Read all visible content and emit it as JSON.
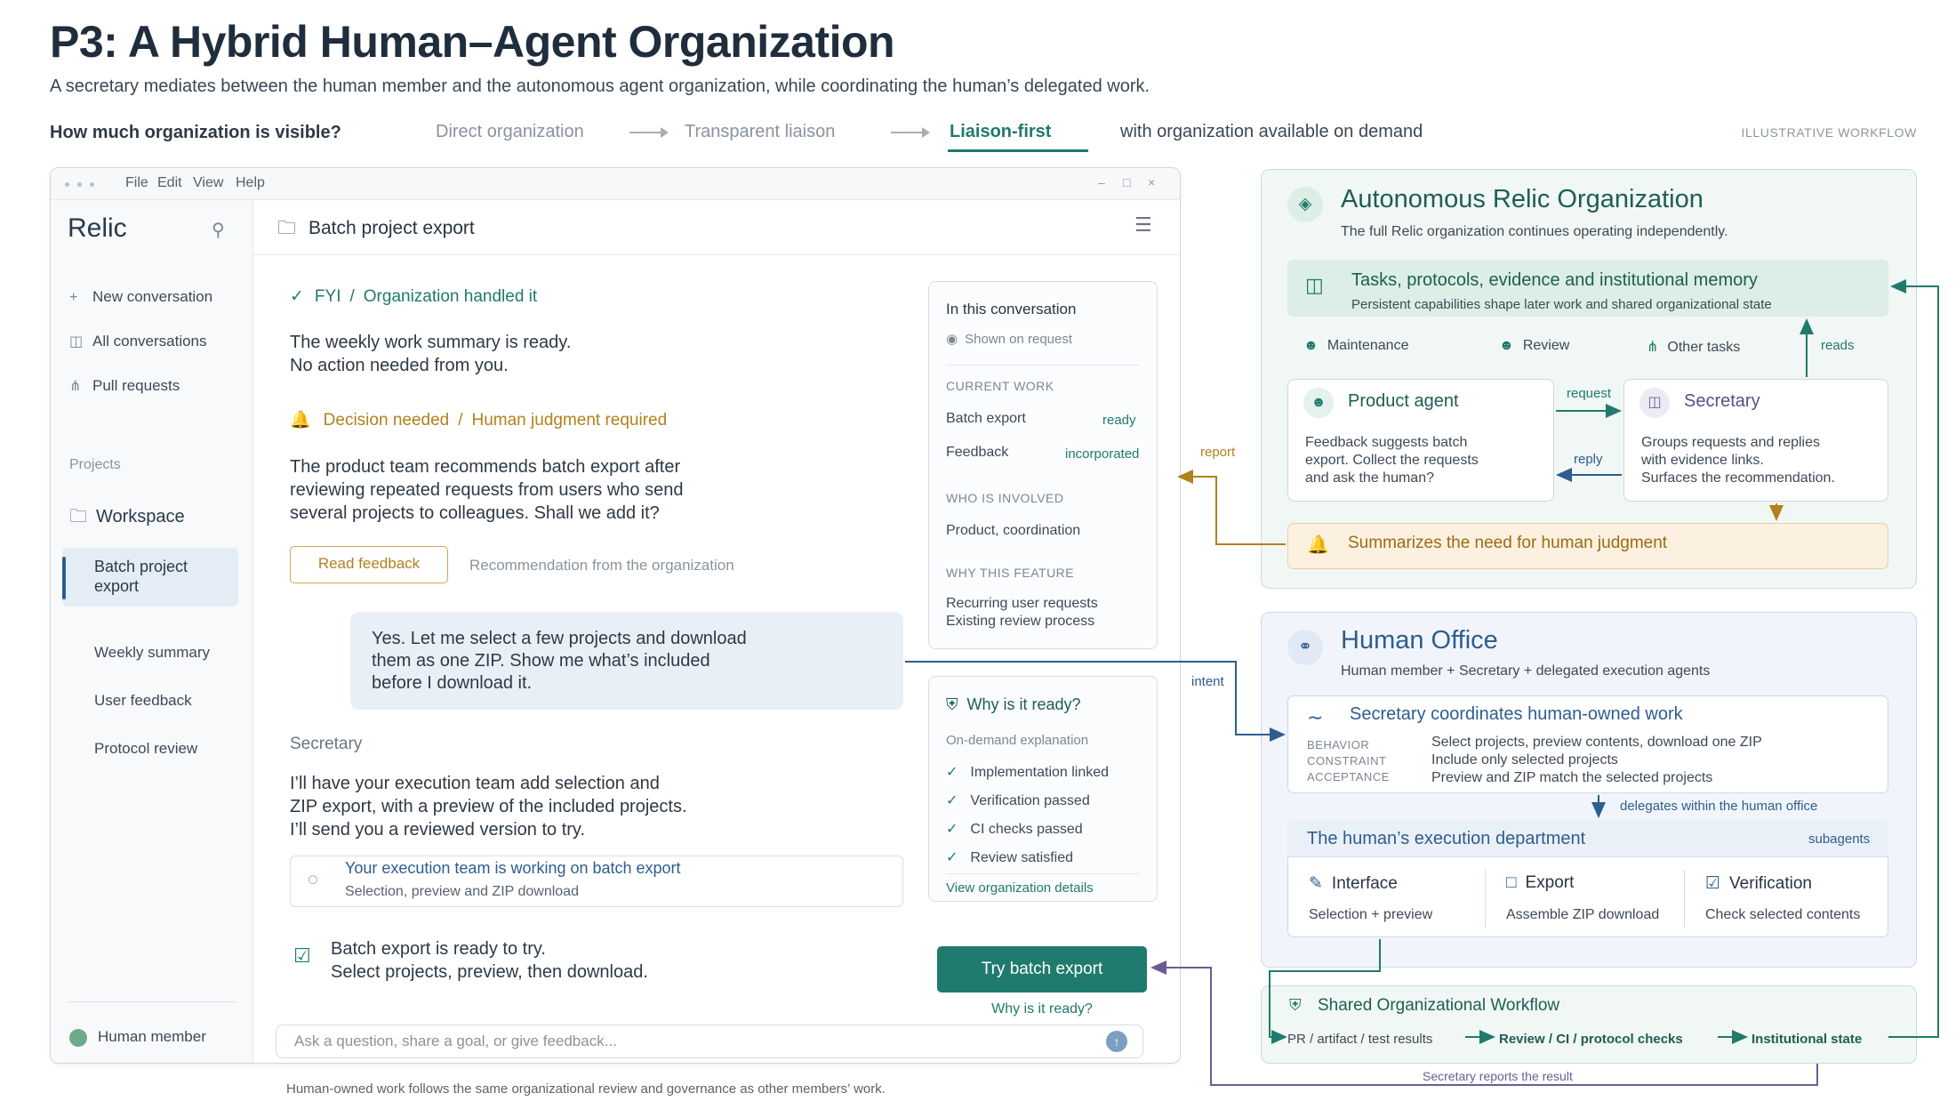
{
  "header": {
    "title": "P3: A Hybrid Human–Agent Organization",
    "subtitle": "A secretary mediates between the human member and the autonomous agent organization, while coordinating the human’s delegated work.",
    "question": "How much organization is visible?",
    "steps": [
      "Direct organization",
      "Transparent liaison",
      "Liaison-first"
    ],
    "step_suffix": "with organization available on demand",
    "tag": "ILLUSTRATIVE WORKFLOW"
  },
  "app": {
    "menu": [
      "File",
      "Edit",
      "View",
      "Help"
    ],
    "win_controls": [
      "–",
      "□",
      "×"
    ],
    "sidebar": {
      "brand": "Relic",
      "links": [
        "New conversation",
        "All conversations",
        "Pull requests"
      ],
      "projects_label": "Projects",
      "workspace": "Workspace",
      "active_item": "Batch project export",
      "sub_items": [
        "Weekly summary",
        "User feedback",
        "Protocol review"
      ],
      "user": "Human member"
    },
    "conversation": {
      "title": "Batch project export",
      "fyi_tag": "FYI",
      "fyi_detail": "Organization handled it",
      "fyi_lines": [
        "The weekly work summary is ready.",
        "No action needed from you."
      ],
      "decision_tag": "Decision needed",
      "decision_detail": "Human judgment required",
      "decision_lines": [
        "The product team recommends batch export after",
        "reviewing repeated requests from users who send",
        "several projects to colleagues. Shall we add it?"
      ],
      "read_feedback": "Read feedback",
      "recommendation_note": "Recommendation from the organization",
      "user_lines": [
        "Yes. Let me select a few projects and download",
        "them as one ZIP. Show me what’s included",
        "before I download it."
      ],
      "secretary_label": "Secretary",
      "secretary_lines": [
        "I’ll have your execution team add selection and",
        "ZIP export, with a preview of the included projects.",
        "I’ll send you a reviewed version to try."
      ],
      "exec_title": "Your execution team is working on batch export",
      "exec_sub": "Selection, preview and ZIP download",
      "ready_lines": [
        "Batch export is ready to try.",
        "Select projects, preview, then download."
      ],
      "input_placeholder": "Ask a question, share a goal, or give feedback...",
      "send_icon": "↑"
    },
    "panel_conv": {
      "title": "In this conversation",
      "shown": "Shown on request",
      "current_work_cap": "CURRENT WORK",
      "work": [
        {
          "label": "Batch export",
          "status": "ready"
        },
        {
          "label": "Feedback",
          "status": "incorporated"
        }
      ],
      "who_cap": "WHO IS INVOLVED",
      "who": "Product, coordination",
      "why_cap": "WHY THIS FEATURE",
      "why_lines": [
        "Recurring user requests",
        "Existing review process"
      ]
    },
    "panel_ready": {
      "title": "Why is it ready?",
      "sub": "On-demand explanation",
      "checks": [
        "Implementation linked",
        "Verification passed",
        "CI checks passed",
        "Review satisfied"
      ],
      "link": "View organization details"
    },
    "try_button": "Try batch export",
    "why_link": "Why is it ready?"
  },
  "diagram": {
    "org": {
      "title": "Autonomous Relic Organization",
      "sub": "The full Relic organization continues operating independently.",
      "memory_title": "Tasks, protocols, evidence and institutional memory",
      "memory_sub": "Persistent capabilities shape later work and shared organizational state",
      "roles": [
        "Maintenance",
        "Review",
        "Other tasks"
      ],
      "reads": "reads",
      "product_title": "Product agent",
      "product_lines": [
        "Feedback suggests batch",
        "export. Collect the requests",
        "and ask the human?"
      ],
      "request": "request",
      "reply": "reply",
      "secretary_title": "Secretary",
      "secretary_lines": [
        "Groups requests and replies",
        "with evidence links.",
        "Surfaces the recommendation."
      ],
      "summary": "Summarizes the need for human judgment",
      "report": "report"
    },
    "office": {
      "title": "Human Office",
      "sub": "Human member + Secretary + delegated execution agents",
      "intent": "intent",
      "coord_title": "Secretary coordinates human-owned work",
      "coord_rows": [
        {
          "cap": "BEHAVIOR",
          "val": "Select projects, preview contents, download one ZIP"
        },
        {
          "cap": "CONSTRAINT",
          "val": "Include only selected projects"
        },
        {
          "cap": "ACCEPTANCE",
          "val": "Preview and ZIP match the selected projects"
        }
      ],
      "delegates": "delegates within the human office",
      "dept_title": "The human’s execution department",
      "dept_tag": "subagents",
      "dept_cols": [
        {
          "title": "Interface",
          "sub": "Selection + preview",
          "icon": "✎"
        },
        {
          "title": "Export",
          "sub": "Assemble ZIP download",
          "icon": "□"
        },
        {
          "title": "Verification",
          "sub": "Check selected contents",
          "icon": "☑"
        }
      ]
    },
    "shared": {
      "title": "Shared Organizational Workflow",
      "flow": [
        "PR / artifact / test results",
        "Review / CI / protocol checks",
        "Institutional state"
      ],
      "secretary_reports": "Secretary reports the result"
    },
    "footnote": "Human-owned work follows the same organizational review and governance as other members’ work."
  },
  "colors": {
    "green": "#207a6d",
    "blue": "#2e5d8e",
    "amber": "#b3811d",
    "purple": "#6b5c95"
  }
}
